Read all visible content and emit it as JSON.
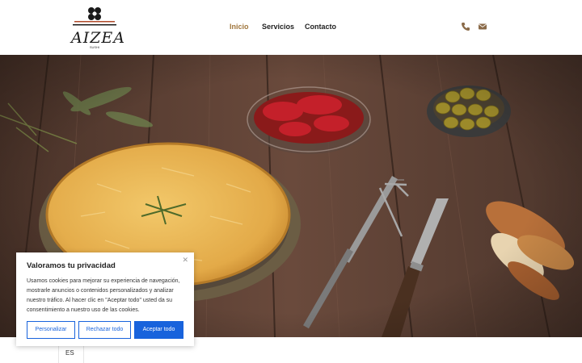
{
  "header": {
    "logo_text": "AIZEA",
    "logo_sub": "SUSHI",
    "nav": [
      "Inicio",
      "Servicios",
      "Contacto"
    ],
    "active_nav": "Inicio",
    "icons": [
      "phone-icon",
      "mail-icon"
    ],
    "accent_color": "#a0763c"
  },
  "cookie": {
    "title": "Valoramos tu privacidad",
    "text": "Usamos cookies para mejorar su experiencia de navegación, mostrarle anuncios o contenidos personalizados y analizar nuestro tráfico. Al hacer clic en \"Aceptar todo\" usted da su consentimiento a nuestro uso de las cookies.",
    "buttons": [
      "Personalizar",
      "Rechazar todo",
      "Aceptar todo"
    ],
    "button_color": "#1863dc"
  },
  "language": "ES"
}
